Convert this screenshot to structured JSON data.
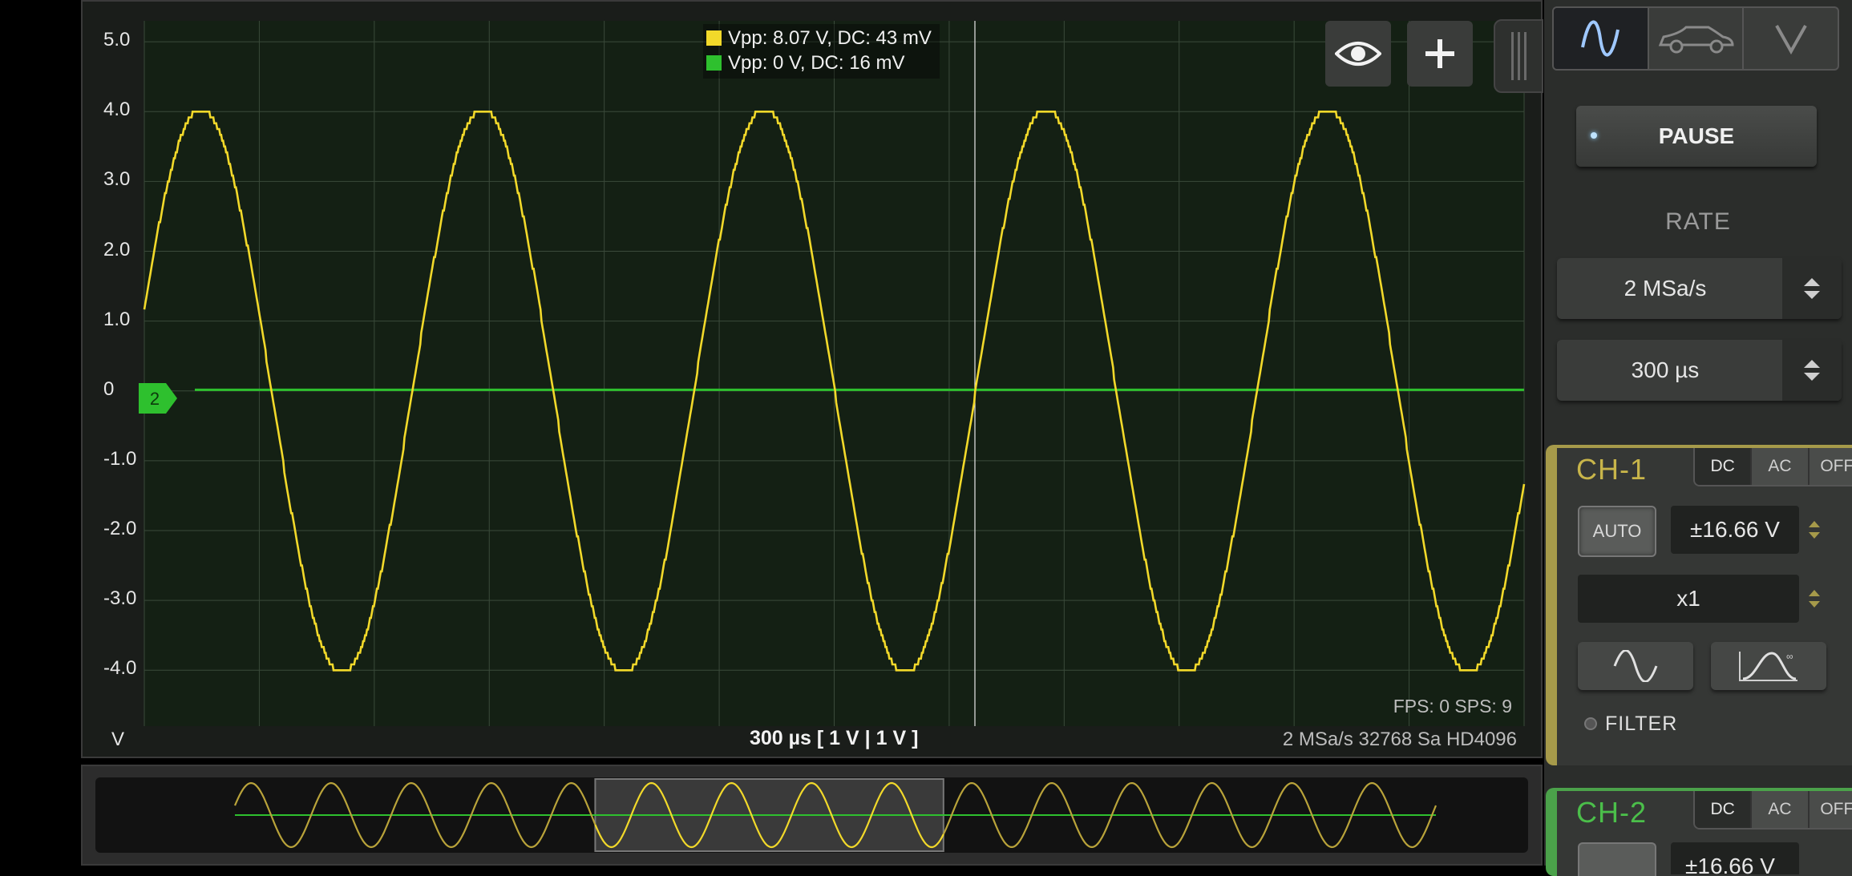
{
  "scope": {
    "y_ticks": [
      "5.0",
      "4.0",
      "3.0",
      "2.0",
      "1.0",
      "0",
      "-1.0",
      "-2.0",
      "-3.0",
      "-4.0"
    ],
    "unit_label": "V",
    "timebase_label": "300 µs  [ 1 V | 1 V ]",
    "status_right": "2 MSa/s   32768 Sa   HD4096",
    "fps_label": "FPS: 0   SPS: 9",
    "legend": [
      {
        "text": "Vpp: 8.07 V, DC: 43 mV",
        "color": "#f2d92a"
      },
      {
        "text": "Vpp: 0 V, DC: 16 mV",
        "color": "#2ec02e"
      }
    ],
    "channel2_marker": "2",
    "icons": [
      "eye-icon",
      "plus-icon",
      "grip-icon"
    ]
  },
  "chart_data": {
    "type": "line",
    "xlabel": "",
    "ylabel": "V",
    "ylim": [
      -4.8,
      5.3
    ],
    "x_unit_per_div": "300 µs",
    "grid": true,
    "series": [
      {
        "color": "#f2d92a",
        "waveform": "sine",
        "amplitude": 4.04,
        "offset": 0.043,
        "visible_cycles": 4.9,
        "start_value": 1.2
      },
      {
        "color": "#2ec02e",
        "waveform": "dc",
        "offset": 0.016
      }
    ]
  },
  "overview": {
    "trace_color": "#b9a33a",
    "highlight_color": "#f2d92a",
    "cycles": 15,
    "window_fraction": [
      0.3,
      0.59
    ]
  },
  "panel": {
    "tabs": [
      "scope-wave-icon",
      "car-icon",
      "v-icon"
    ],
    "pause_label": "PAUSE",
    "rate_title": "RATE",
    "sample_rate": "2 MSa/s",
    "timebase": "300 µs",
    "ch1": {
      "title": "CH-1",
      "color": "#c8b54a",
      "coupling": [
        "DC",
        "AC",
        "OFF"
      ],
      "coupling_selected": "DC",
      "auto_label": "AUTO",
      "range": "±16.66 V",
      "probe": "x1",
      "filter_label": "FILTER"
    },
    "ch2": {
      "title": "CH-2",
      "color": "#4bbf4a",
      "coupling": [
        "DC",
        "AC",
        "OFF"
      ],
      "coupling_selected": "DC",
      "range": "±16.66 V"
    }
  }
}
